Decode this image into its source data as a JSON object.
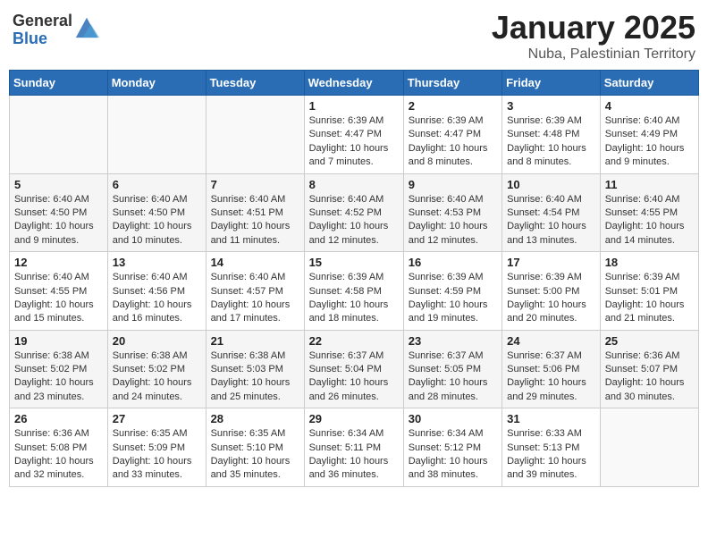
{
  "logo": {
    "general": "General",
    "blue": "Blue"
  },
  "header": {
    "title": "January 2025",
    "subtitle": "Nuba, Palestinian Territory"
  },
  "weekdays": [
    "Sunday",
    "Monday",
    "Tuesday",
    "Wednesday",
    "Thursday",
    "Friday",
    "Saturday"
  ],
  "weeks": [
    [
      null,
      null,
      null,
      {
        "day": 1,
        "sunrise": "6:39 AM",
        "sunset": "4:47 PM",
        "daylight": "10 hours and 7 minutes."
      },
      {
        "day": 2,
        "sunrise": "6:39 AM",
        "sunset": "4:47 PM",
        "daylight": "10 hours and 8 minutes."
      },
      {
        "day": 3,
        "sunrise": "6:39 AM",
        "sunset": "4:48 PM",
        "daylight": "10 hours and 8 minutes."
      },
      {
        "day": 4,
        "sunrise": "6:40 AM",
        "sunset": "4:49 PM",
        "daylight": "10 hours and 9 minutes."
      }
    ],
    [
      {
        "day": 5,
        "sunrise": "6:40 AM",
        "sunset": "4:50 PM",
        "daylight": "10 hours and 9 minutes."
      },
      {
        "day": 6,
        "sunrise": "6:40 AM",
        "sunset": "4:50 PM",
        "daylight": "10 hours and 10 minutes."
      },
      {
        "day": 7,
        "sunrise": "6:40 AM",
        "sunset": "4:51 PM",
        "daylight": "10 hours and 11 minutes."
      },
      {
        "day": 8,
        "sunrise": "6:40 AM",
        "sunset": "4:52 PM",
        "daylight": "10 hours and 12 minutes."
      },
      {
        "day": 9,
        "sunrise": "6:40 AM",
        "sunset": "4:53 PM",
        "daylight": "10 hours and 12 minutes."
      },
      {
        "day": 10,
        "sunrise": "6:40 AM",
        "sunset": "4:54 PM",
        "daylight": "10 hours and 13 minutes."
      },
      {
        "day": 11,
        "sunrise": "6:40 AM",
        "sunset": "4:55 PM",
        "daylight": "10 hours and 14 minutes."
      }
    ],
    [
      {
        "day": 12,
        "sunrise": "6:40 AM",
        "sunset": "4:55 PM",
        "daylight": "10 hours and 15 minutes."
      },
      {
        "day": 13,
        "sunrise": "6:40 AM",
        "sunset": "4:56 PM",
        "daylight": "10 hours and 16 minutes."
      },
      {
        "day": 14,
        "sunrise": "6:40 AM",
        "sunset": "4:57 PM",
        "daylight": "10 hours and 17 minutes."
      },
      {
        "day": 15,
        "sunrise": "6:39 AM",
        "sunset": "4:58 PM",
        "daylight": "10 hours and 18 minutes."
      },
      {
        "day": 16,
        "sunrise": "6:39 AM",
        "sunset": "4:59 PM",
        "daylight": "10 hours and 19 minutes."
      },
      {
        "day": 17,
        "sunrise": "6:39 AM",
        "sunset": "5:00 PM",
        "daylight": "10 hours and 20 minutes."
      },
      {
        "day": 18,
        "sunrise": "6:39 AM",
        "sunset": "5:01 PM",
        "daylight": "10 hours and 21 minutes."
      }
    ],
    [
      {
        "day": 19,
        "sunrise": "6:38 AM",
        "sunset": "5:02 PM",
        "daylight": "10 hours and 23 minutes."
      },
      {
        "day": 20,
        "sunrise": "6:38 AM",
        "sunset": "5:02 PM",
        "daylight": "10 hours and 24 minutes."
      },
      {
        "day": 21,
        "sunrise": "6:38 AM",
        "sunset": "5:03 PM",
        "daylight": "10 hours and 25 minutes."
      },
      {
        "day": 22,
        "sunrise": "6:37 AM",
        "sunset": "5:04 PM",
        "daylight": "10 hours and 26 minutes."
      },
      {
        "day": 23,
        "sunrise": "6:37 AM",
        "sunset": "5:05 PM",
        "daylight": "10 hours and 28 minutes."
      },
      {
        "day": 24,
        "sunrise": "6:37 AM",
        "sunset": "5:06 PM",
        "daylight": "10 hours and 29 minutes."
      },
      {
        "day": 25,
        "sunrise": "6:36 AM",
        "sunset": "5:07 PM",
        "daylight": "10 hours and 30 minutes."
      }
    ],
    [
      {
        "day": 26,
        "sunrise": "6:36 AM",
        "sunset": "5:08 PM",
        "daylight": "10 hours and 32 minutes."
      },
      {
        "day": 27,
        "sunrise": "6:35 AM",
        "sunset": "5:09 PM",
        "daylight": "10 hours and 33 minutes."
      },
      {
        "day": 28,
        "sunrise": "6:35 AM",
        "sunset": "5:10 PM",
        "daylight": "10 hours and 35 minutes."
      },
      {
        "day": 29,
        "sunrise": "6:34 AM",
        "sunset": "5:11 PM",
        "daylight": "10 hours and 36 minutes."
      },
      {
        "day": 30,
        "sunrise": "6:34 AM",
        "sunset": "5:12 PM",
        "daylight": "10 hours and 38 minutes."
      },
      {
        "day": 31,
        "sunrise": "6:33 AM",
        "sunset": "5:13 PM",
        "daylight": "10 hours and 39 minutes."
      },
      null
    ]
  ]
}
